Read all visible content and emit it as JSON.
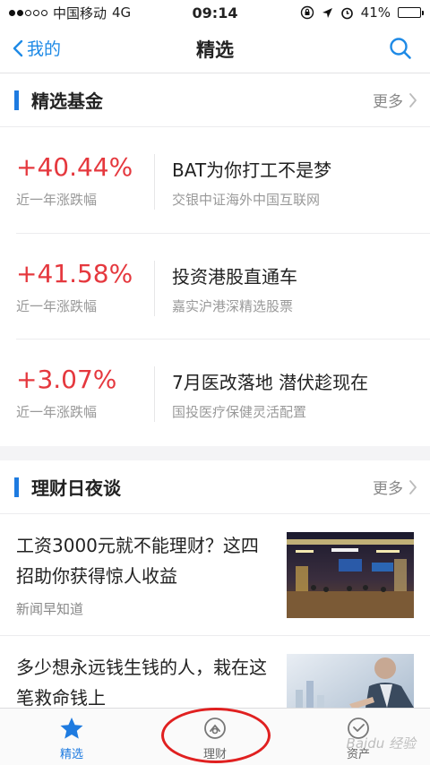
{
  "status_bar": {
    "carrier": "中国移动",
    "network": "4G",
    "time": "09:14",
    "battery": "41%",
    "battery_level": 0.41
  },
  "nav": {
    "back_label": "我的",
    "title": "精选"
  },
  "funds_section": {
    "title": "精选基金",
    "more_label": "更多",
    "items": [
      {
        "pct": "+40.44%",
        "pct_label": "近一年涨跌幅",
        "name": "BAT为你打工不是梦",
        "desc": "交银中证海外中国互联网"
      },
      {
        "pct": "+41.58%",
        "pct_label": "近一年涨跌幅",
        "name": "投资港股直通车",
        "desc": "嘉实沪港深精选股票"
      },
      {
        "pct": "+3.07%",
        "pct_label": "近一年涨跌幅",
        "name": "7月医改落地 潜伏趁现在",
        "desc": "国投医疗保健灵活配置"
      }
    ]
  },
  "talk_section": {
    "title": "理财日夜谈",
    "more_label": "更多",
    "articles": [
      {
        "title": "工资3000元就不能理财？这四招助你获得惊人收益",
        "source": "新闻早知道"
      },
      {
        "title": "多少想永远钱生钱的人，栽在这笔救命钱上",
        "source": ""
      }
    ]
  },
  "tabs": [
    {
      "label": "精选",
      "icon": "star-icon",
      "active": true
    },
    {
      "label": "理财",
      "icon": "wealth-icon",
      "active": false
    },
    {
      "label": "资产",
      "icon": "assets-icon",
      "active": false
    }
  ],
  "watermark": "Baidu 经验",
  "colors": {
    "accent": "#1e7be0",
    "gain": "#e5383e",
    "annotation": "#e02020"
  }
}
